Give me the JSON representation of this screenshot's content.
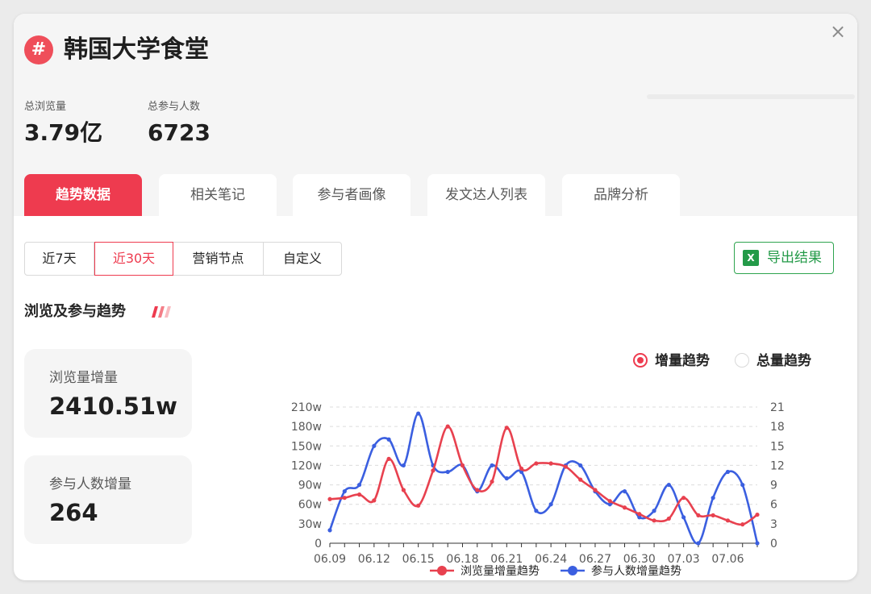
{
  "header": {
    "hash_symbol": "#",
    "title": "韩国大学食堂",
    "close_symbol": "×"
  },
  "stats": [
    {
      "label": "总浏览量",
      "value": "3.79亿"
    },
    {
      "label": "总参与人数",
      "value": "6723"
    }
  ],
  "tabs": [
    {
      "label": "趋势数据",
      "active": true
    },
    {
      "label": "相关笔记"
    },
    {
      "label": "参与者画像"
    },
    {
      "label": "发文达人列表"
    },
    {
      "label": "品牌分析"
    }
  ],
  "range": {
    "options": [
      "近7天",
      "近30天",
      "营销节点",
      "自定义"
    ],
    "selected": "近30天"
  },
  "export": {
    "icon_text": "X",
    "label": "导出结果"
  },
  "section": {
    "title": "浏览及参与趋势"
  },
  "summary": [
    {
      "label": "浏览量增量",
      "value": "2410.51w"
    },
    {
      "label": "参与人数增量",
      "value": "264"
    }
  ],
  "mode": {
    "options": [
      "增量趋势",
      "总量趋势"
    ],
    "selected": "增量趋势"
  },
  "colors": {
    "red": "#e8414f",
    "blue": "#3b5fe0",
    "accent": "#ee3b4f",
    "green": "#239a48"
  },
  "chart_data": {
    "type": "line",
    "x": [
      "06.09",
      "06.10",
      "06.11",
      "06.12",
      "06.13",
      "06.14",
      "06.15",
      "06.16",
      "06.17",
      "06.18",
      "06.19",
      "06.20",
      "06.21",
      "06.22",
      "06.23",
      "06.24",
      "06.25",
      "06.26",
      "06.27",
      "06.28",
      "06.29",
      "06.30",
      "07.01",
      "07.02",
      "07.03",
      "07.04",
      "07.05",
      "07.06",
      "07.07",
      "07.08"
    ],
    "x_tick_labels": [
      "06.09",
      "06.12",
      "06.15",
      "06.18",
      "06.21",
      "06.24",
      "06.27",
      "06.30",
      "07.03",
      "07.06"
    ],
    "y_left_ticks": [
      "0",
      "30w",
      "60w",
      "90w",
      "120w",
      "150w",
      "180w",
      "210w"
    ],
    "y_left_lim": [
      0,
      210
    ],
    "y_right_ticks": [
      "0",
      "3",
      "6",
      "9",
      "12",
      "15",
      "18",
      "21"
    ],
    "y_right_lim": [
      0,
      21
    ],
    "grid": true,
    "legend_position": "bottom",
    "series": [
      {
        "name": "浏览量增量趋势",
        "axis": "left",
        "color": "#e8414f",
        "values": [
          68,
          70,
          75,
          66,
          130,
          82,
          58,
          112,
          180,
          120,
          82,
          95,
          178,
          115,
          123,
          123,
          118,
          98,
          82,
          65,
          55,
          45,
          35,
          38,
          70,
          43,
          43,
          35,
          29,
          44
        ]
      },
      {
        "name": "参与人数增量趋势",
        "axis": "right",
        "color": "#3b5fe0",
        "values": [
          2,
          8,
          9,
          15,
          16,
          12,
          20,
          12,
          11,
          12,
          8,
          12,
          10,
          11,
          5,
          6,
          12,
          12,
          8,
          6,
          8,
          4,
          5,
          9,
          4,
          0,
          7,
          11,
          9,
          0
        ]
      }
    ]
  }
}
